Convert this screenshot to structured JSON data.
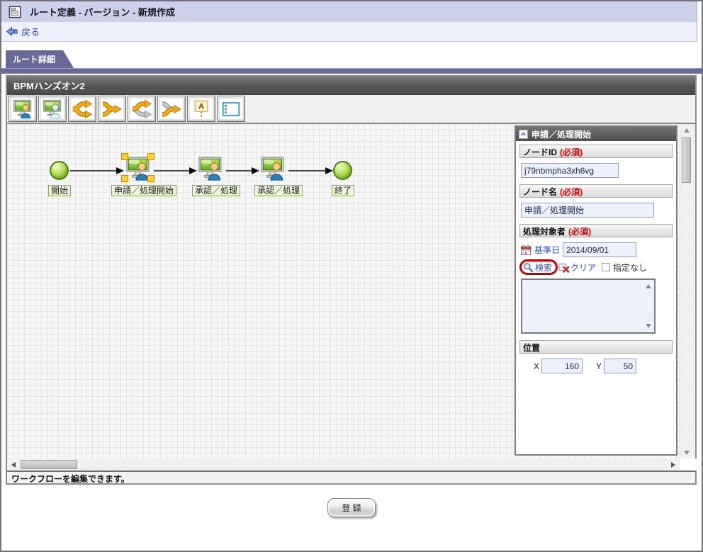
{
  "window": {
    "title": "ルート定義 - バージョン - 新規作成"
  },
  "nav": {
    "back_label": "戻る"
  },
  "tabs": {
    "detail_label": "ルート詳細"
  },
  "workflow": {
    "title": "BPMハンズオン2",
    "toolbar_icons": [
      "task-node-icon",
      "dynamic-task-node-icon",
      "split-branch-icon",
      "join-branch-icon",
      "split-sync-branch-icon",
      "join-sync-branch-icon",
      "annotation-icon",
      "swimlane-icon"
    ],
    "nodes": [
      {
        "type": "start",
        "label": "開始"
      },
      {
        "type": "task",
        "label": "申請／処理開始",
        "selected": true
      },
      {
        "type": "task",
        "label": "承認／処理"
      },
      {
        "type": "task",
        "label": "承認／処理"
      },
      {
        "type": "end",
        "label": "終了"
      }
    ],
    "status": "ワークフローを編集できます。"
  },
  "properties": {
    "title": "申請／処理開始",
    "node_id": {
      "label": "ノードID",
      "required": "(必須)",
      "value": "j79nbmpha3xh6vg"
    },
    "node_name": {
      "label": "ノード名",
      "required": "(必須)",
      "value": "申請／処理開始"
    },
    "target": {
      "label": "処理対象者",
      "required": "(必須)",
      "base_date_label": "基準日",
      "base_date_value": "2014/09/01",
      "search_label": "検索",
      "clear_label": "クリア",
      "none_label": "指定なし"
    },
    "position": {
      "label": "位置",
      "x_label": "X",
      "x_value": "160",
      "y_label": "Y",
      "y_value": "50"
    }
  },
  "footer": {
    "register_label": "登 録"
  },
  "colors": {
    "accent_purple": "#686899",
    "titlebar_lavender": "#cdd0e9",
    "link_blue": "#2b4cc4",
    "required_red": "#e00000",
    "search_highlight_red": "#c60000",
    "node_green": "#82c02c"
  }
}
